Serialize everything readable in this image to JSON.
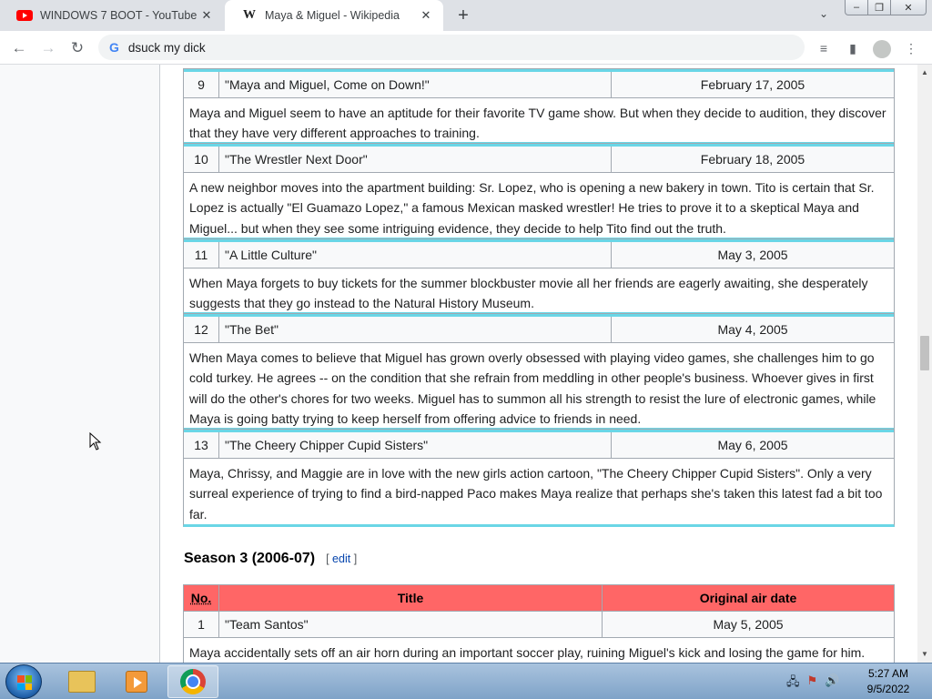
{
  "tabs": [
    {
      "title": "WINDOWS 7 BOOT - YouTube",
      "favicon": "youtube-icon",
      "active": false
    },
    {
      "title": "Maya & Miguel - Wikipedia",
      "favicon": "wikipedia-icon",
      "active": true
    }
  ],
  "toolbar": {
    "address": "dsuck my dick"
  },
  "episodes": [
    {
      "no": "9",
      "title": "\"Maya and Miguel, Come on Down!\"",
      "date": "February 17, 2005",
      "summary": "Maya and Miguel seem to have an aptitude for their favorite TV game show. But when they decide to audition, they discover that they have very different approaches to training."
    },
    {
      "no": "10",
      "title": "\"The Wrestler Next Door\"",
      "date": "February 18, 2005",
      "summary": "A new neighbor moves into the apartment building: Sr. Lopez, who is opening a new bakery in town. Tito is certain that Sr. Lopez is actually \"El Guamazo Lopez,\" a famous Mexican masked wrestler! He tries to prove it to a skeptical Maya and Miguel... but when they see some intriguing evidence, they decide to help Tito find out the truth."
    },
    {
      "no": "11",
      "title": "\"A Little Culture\"",
      "date": "May 3, 2005",
      "summary": "When Maya forgets to buy tickets for the summer blockbuster movie all her friends are eagerly awaiting, she desperately suggests that they go instead to the Natural History Museum."
    },
    {
      "no": "12",
      "title": "\"The Bet\"",
      "date": "May 4, 2005",
      "summary": "When Maya comes to believe that Miguel has grown overly obsessed with playing video games, she challenges him to go cold turkey. He agrees -- on the condition that she refrain from meddling in other people's business. Whoever gives in first will do the other's chores for two weeks. Miguel has to summon all his strength to resist the lure of electronic games, while Maya is going batty trying to keep herself from offering advice to friends in need."
    },
    {
      "no": "13",
      "title": "\"The Cheery Chipper Cupid Sisters\"",
      "date": "May 6, 2005",
      "summary": "Maya, Chrissy, and Maggie are in love with the new girls action cartoon, \"The Cheery Chipper Cupid Sisters\". Only a very surreal experience of trying to find a bird-napped Paco makes Maya realize that perhaps she's taken this latest fad a bit too far."
    }
  ],
  "season3": {
    "heading": "Season 3 (2006-07)",
    "edit_open": "[",
    "edit_label": "edit",
    "edit_close": "]",
    "headers": {
      "no": "No.",
      "title": "Title",
      "date": "Original air date"
    },
    "header_color": "#ff6666",
    "rows": [
      {
        "no": "1",
        "title": "\"Team Santos\"",
        "date": "May 5, 2005",
        "summary": "Maya accidentally sets off an air horn during an important soccer play, ruining Miguel's kick and losing the game for him."
      }
    ]
  },
  "accent_color": "#6ad6e6",
  "taskbar": {
    "time": "5:27 AM",
    "date": "9/5/2022",
    "pinned": [
      "windows-explorer-icon",
      "media-player-icon",
      "chrome-icon"
    ]
  }
}
